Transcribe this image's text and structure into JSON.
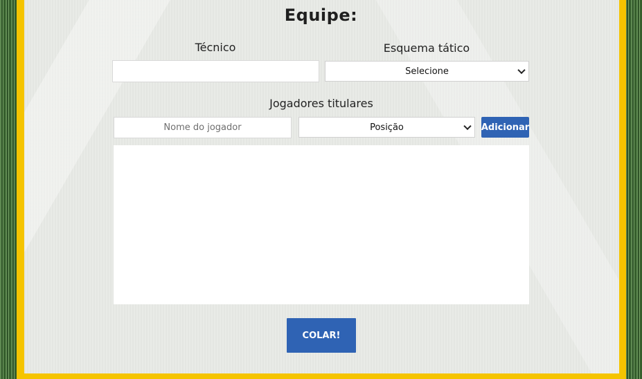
{
  "team_form": {
    "title": "Equipe:",
    "coach": {
      "label": "Técnico",
      "value": ""
    },
    "formation": {
      "label": "Esquema tático",
      "selected": "Selecione"
    },
    "starters": {
      "label": "Jogadores titulares",
      "player_name_placeholder": "Nome do jogador",
      "position_selected": "Posição",
      "add_button": "Adicionar"
    },
    "submit_button": "COLAR!"
  }
}
